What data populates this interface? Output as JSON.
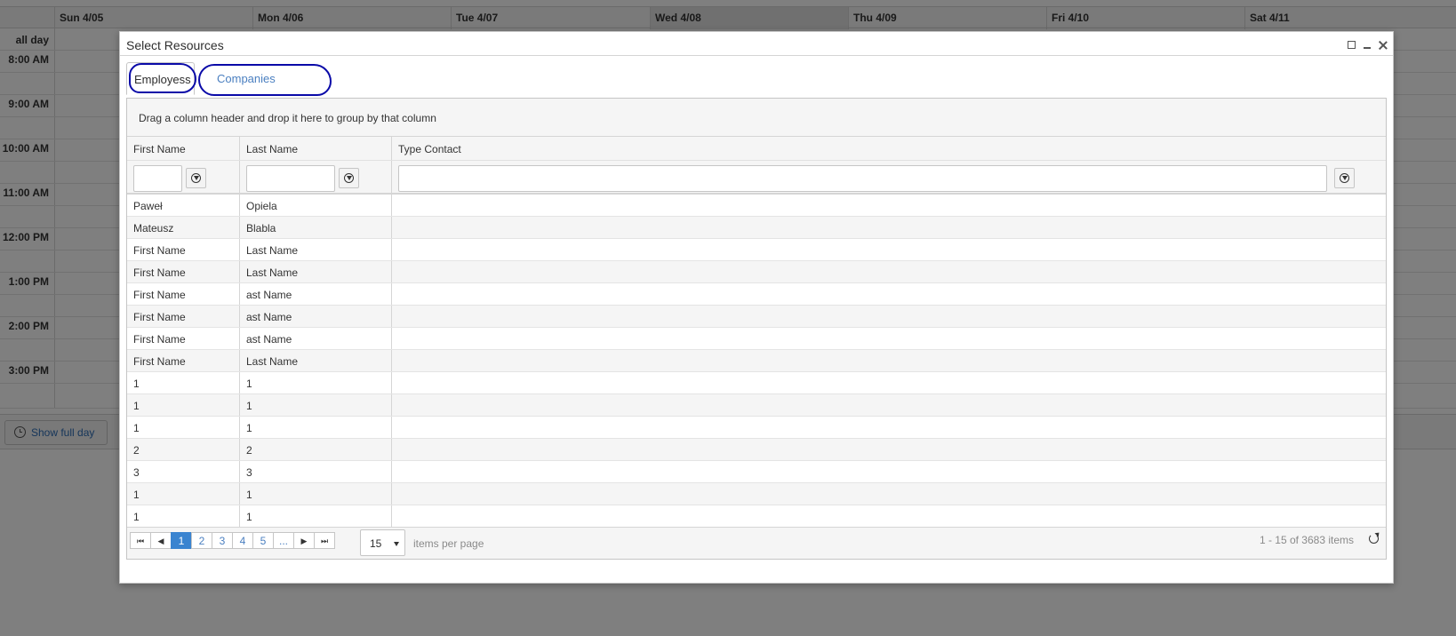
{
  "scheduler": {
    "days": [
      {
        "label": "Sun 4/05"
      },
      {
        "label": "Mon 4/06"
      },
      {
        "label": "Tue 4/07"
      },
      {
        "label": "Wed 4/08"
      },
      {
        "label": "Thu 4/09"
      },
      {
        "label": "Fri 4/10"
      },
      {
        "label": "Sat 4/11"
      }
    ],
    "all_day_label": "all day",
    "times": [
      "8:00 AM",
      "9:00 AM",
      "10:00 AM",
      "11:00 AM",
      "12:00 PM",
      "1:00 PM",
      "2:00 PM",
      "3:00 PM"
    ],
    "show_full_day_label": "Show full day"
  },
  "dialog": {
    "title": "Select Resources",
    "tabs": [
      {
        "label": "Employess",
        "active": true
      },
      {
        "label": "Companies",
        "active": false
      }
    ],
    "group_hint": "Drag a column header and drop it here to group by that column",
    "columns": [
      "First Name",
      "Last Name",
      "Type Contact"
    ],
    "rows": [
      [
        "Paweł",
        "Opiela",
        ""
      ],
      [
        "Mateusz",
        "Blabla",
        ""
      ],
      [
        "First Name",
        "Last Name",
        ""
      ],
      [
        "First Name",
        "Last Name",
        ""
      ],
      [
        "First Name",
        "ast Name",
        ""
      ],
      [
        "First Name",
        "ast Name",
        ""
      ],
      [
        "First Name",
        "ast Name",
        ""
      ],
      [
        "First Name",
        "Last Name",
        ""
      ],
      [
        "1",
        "1",
        ""
      ],
      [
        "1",
        "1",
        ""
      ],
      [
        "1",
        "1",
        ""
      ],
      [
        "2",
        "2",
        ""
      ],
      [
        "3",
        "3",
        ""
      ],
      [
        "1",
        "1",
        ""
      ],
      [
        "1",
        "1",
        ""
      ]
    ],
    "pager": {
      "pages": [
        "1",
        "2",
        "3",
        "4",
        "5",
        "..."
      ],
      "current": "1",
      "page_size": "15",
      "items_per_page_label": "items per page",
      "info": "1 - 15 of 3683 items"
    }
  },
  "colors": {
    "accent": "#3a84d0",
    "link": "#4a7fc0",
    "annotation": "#0a0aa8"
  }
}
